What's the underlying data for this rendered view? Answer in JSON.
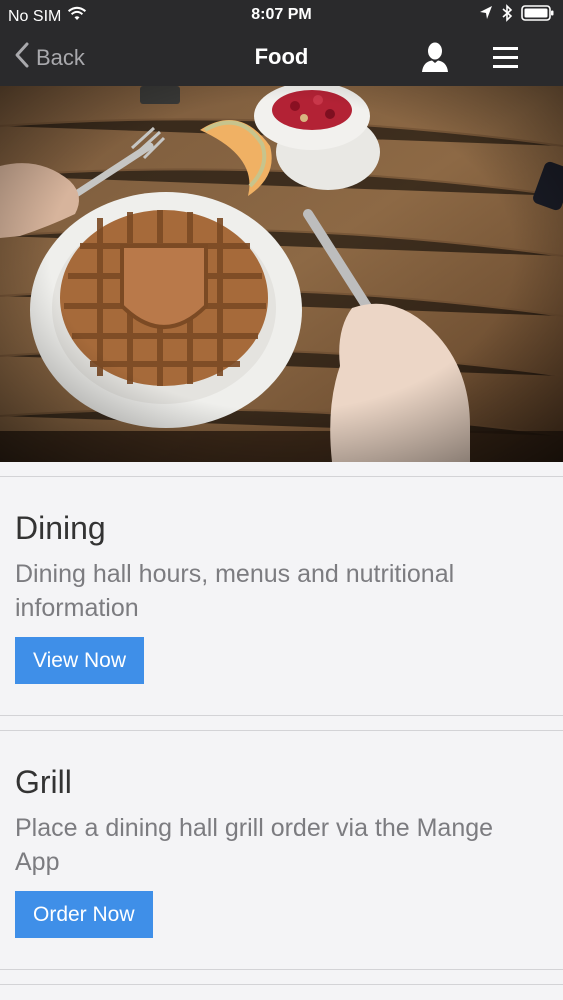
{
  "status_bar": {
    "carrier": "No SIM",
    "time": "8:07 PM",
    "icons": [
      "wifi-icon",
      "location-arrow-icon",
      "bluetooth-icon",
      "battery-icon"
    ]
  },
  "nav": {
    "back_label": "Back",
    "title": "Food",
    "icons": [
      "chevron-left-icon",
      "user-icon",
      "hamburger-menu-icon"
    ]
  },
  "hero_image": {
    "subject": "waffle on a white plate with fork, knife, fruit and yogurt on a wooden table"
  },
  "cards": [
    {
      "title": "Dining",
      "description": "Dining hall hours, menus and nutritional information",
      "button_label": "View Now"
    },
    {
      "title": "Grill",
      "description": "Place a dining hall grill order via the Mange App",
      "button_label": "Order Now"
    }
  ],
  "colors": {
    "bar_background": "#2a2a2c",
    "accent_button": "#3f8fe8",
    "page_background": "#f4f4f6"
  }
}
